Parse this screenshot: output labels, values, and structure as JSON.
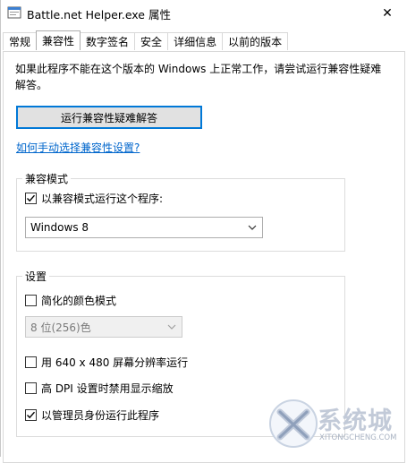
{
  "window": {
    "title": "Battle.net Helper.exe 属性",
    "close_glyph": "✕"
  },
  "tabs": [
    {
      "label": "常规",
      "active": false
    },
    {
      "label": "兼容性",
      "active": true
    },
    {
      "label": "数字签名",
      "active": false
    },
    {
      "label": "安全",
      "active": false
    },
    {
      "label": "详细信息",
      "active": false
    },
    {
      "label": "以前的版本",
      "active": false
    }
  ],
  "compat": {
    "intro_text": "如果此程序不能在这个版本的 Windows 上正常工作，请尝试运行兼容性疑难解答。",
    "run_troubleshooter_label": "运行兼容性疑难解答",
    "manual_link_label": "如何手动选择兼容性设置?"
  },
  "compat_mode": {
    "group_label": "兼容模式",
    "checkbox_label": "以兼容模式运行这个程序:",
    "checkbox_checked": true,
    "selected_os": "Windows 8"
  },
  "settings": {
    "group_label": "设置",
    "reduced_color_label": "简化的颜色模式",
    "reduced_color_checked": false,
    "color_select_value": "8 位(256)色",
    "res_640_label": "用 640 x 480 屏幕分辨率运行",
    "res_640_checked": false,
    "high_dpi_label": "高 DPI 设置时禁用显示缩放",
    "high_dpi_checked": false,
    "admin_label": "以管理员身份运行此程序",
    "admin_checked": true
  },
  "watermark": {
    "brand_text": "系统城",
    "brand_url": "XITONGCHENG.COM"
  },
  "colors": {
    "accent": "#0078d7",
    "link": "#0066cc",
    "button_face": "#e1e1e1",
    "border": "#adadad"
  }
}
